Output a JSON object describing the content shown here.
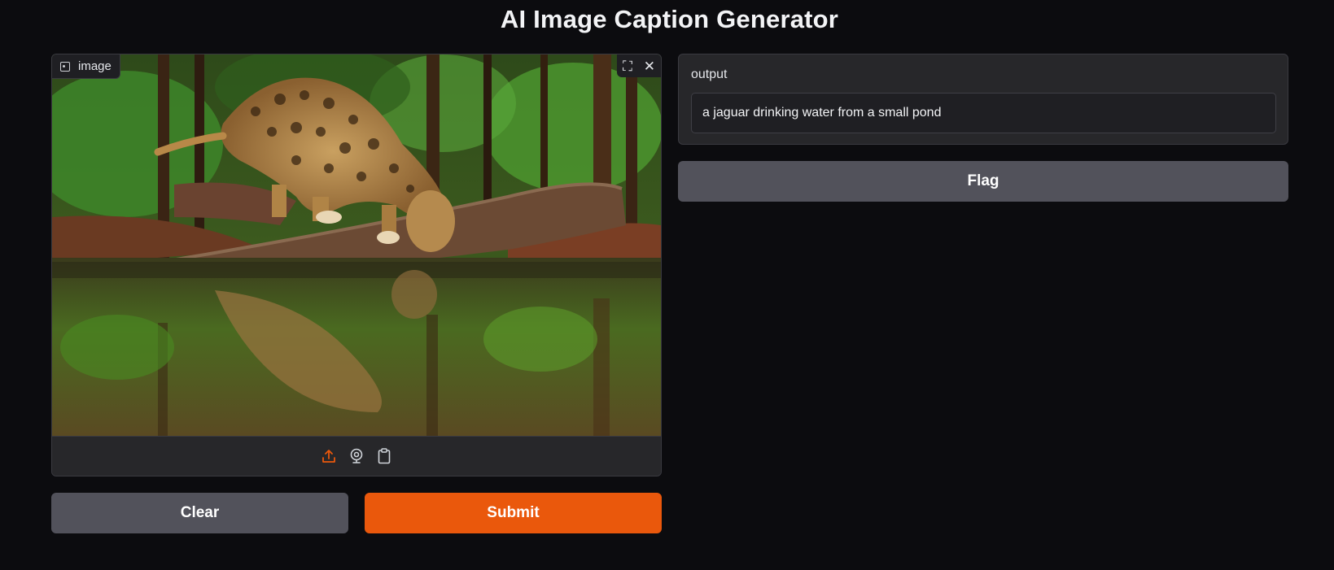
{
  "app": {
    "title": "AI Image Caption Generator"
  },
  "input": {
    "label": "image",
    "icons": {
      "label_icon": "image-icon",
      "fullscreen": "fullscreen-icon",
      "close": "close-icon"
    },
    "sources": [
      "upload-icon",
      "webcam-icon",
      "clipboard-icon"
    ]
  },
  "output": {
    "label": "output",
    "value": "a jaguar drinking water from a small pond"
  },
  "buttons": {
    "clear": "Clear",
    "submit": "Submit",
    "flag": "Flag"
  },
  "colors": {
    "accent": "#ea580c",
    "background": "#0c0c0f",
    "panel": "#27272a",
    "secondary_button": "#52525b"
  }
}
